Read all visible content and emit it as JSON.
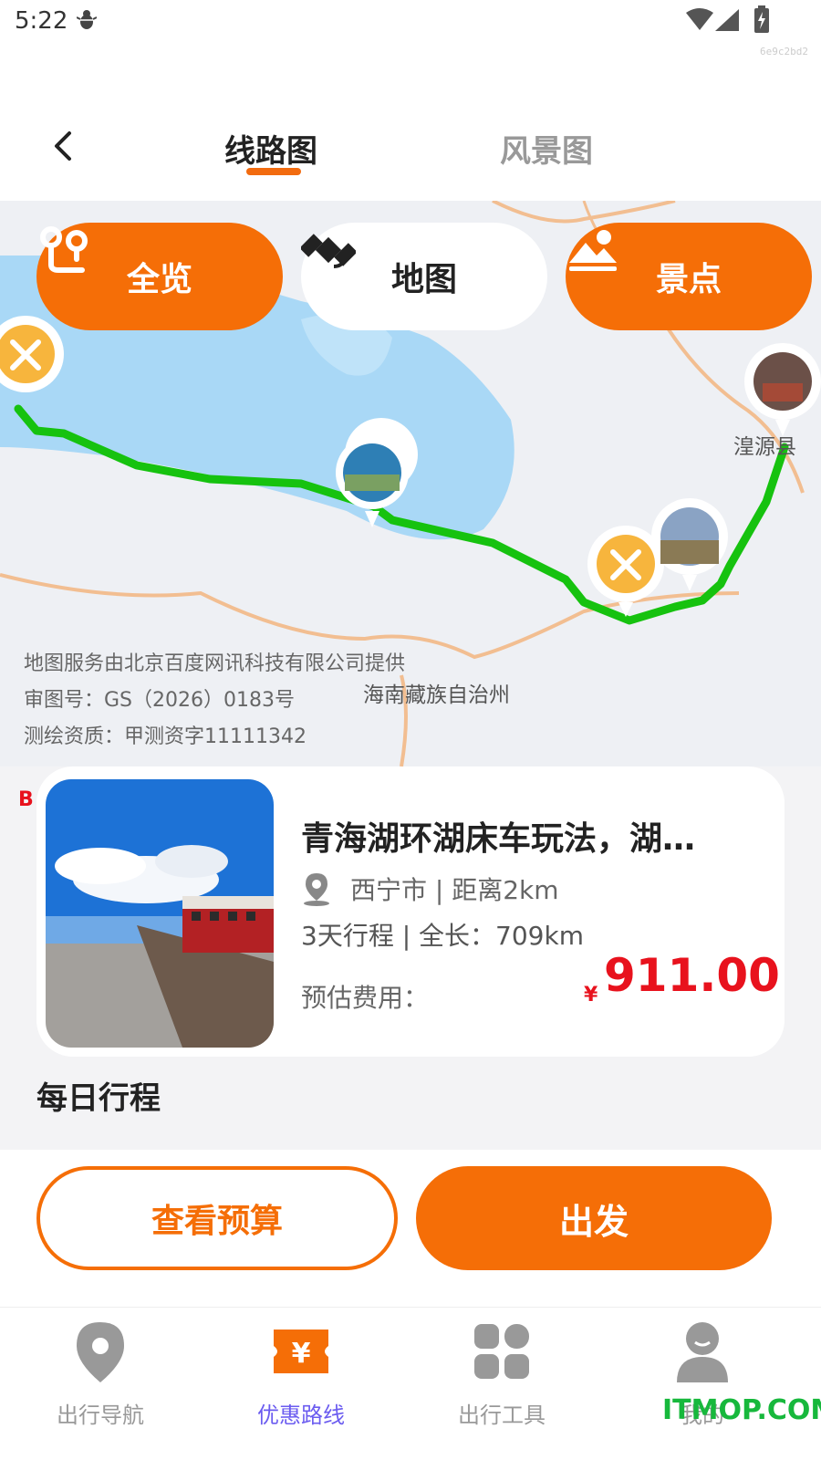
{
  "status_bar": {
    "time": "5:22"
  },
  "build_id": "6e9c2bd2",
  "header": {
    "tabs": [
      {
        "label": "线路图",
        "active": true
      },
      {
        "label": "风景图",
        "active": false
      }
    ]
  },
  "map": {
    "buttons": {
      "overview": "全览",
      "map": "地图",
      "spots": "景点"
    },
    "place_labels": {
      "huangyuan": "湟源县",
      "hainan": "海南藏族自治州"
    },
    "credits": [
      "地图服务由北京百度网讯科技有限公司提供",
      "审图号：GS（2026）0183号",
      "测绘资质：甲测资字11111342"
    ],
    "route_color": "#16c20f"
  },
  "route_card": {
    "badge": "B",
    "title": "青海湖环湖床车玩法，湖…",
    "location": "西宁市 | 距离2km",
    "trip_info": "3天行程 | 全长：709km",
    "cost_label": "预估费用：",
    "currency": "¥",
    "cost": "911.00"
  },
  "daily_title": "每日行程",
  "actions": {
    "budget": "查看预算",
    "depart": "出发"
  },
  "bottom_nav": [
    {
      "label": "出行导航",
      "icon": "location-pin-icon",
      "active": false
    },
    {
      "label": "优惠路线",
      "icon": "yen-ticket-icon",
      "active": true
    },
    {
      "label": "出行工具",
      "icon": "grid-apps-icon",
      "active": false
    },
    {
      "label": "我的",
      "icon": "user-icon",
      "active": false
    }
  ],
  "watermark": "ITMOP.COM",
  "colors": {
    "accent": "#f56e07",
    "price": "#e8121d",
    "nav_active": "#6b5cf0"
  }
}
